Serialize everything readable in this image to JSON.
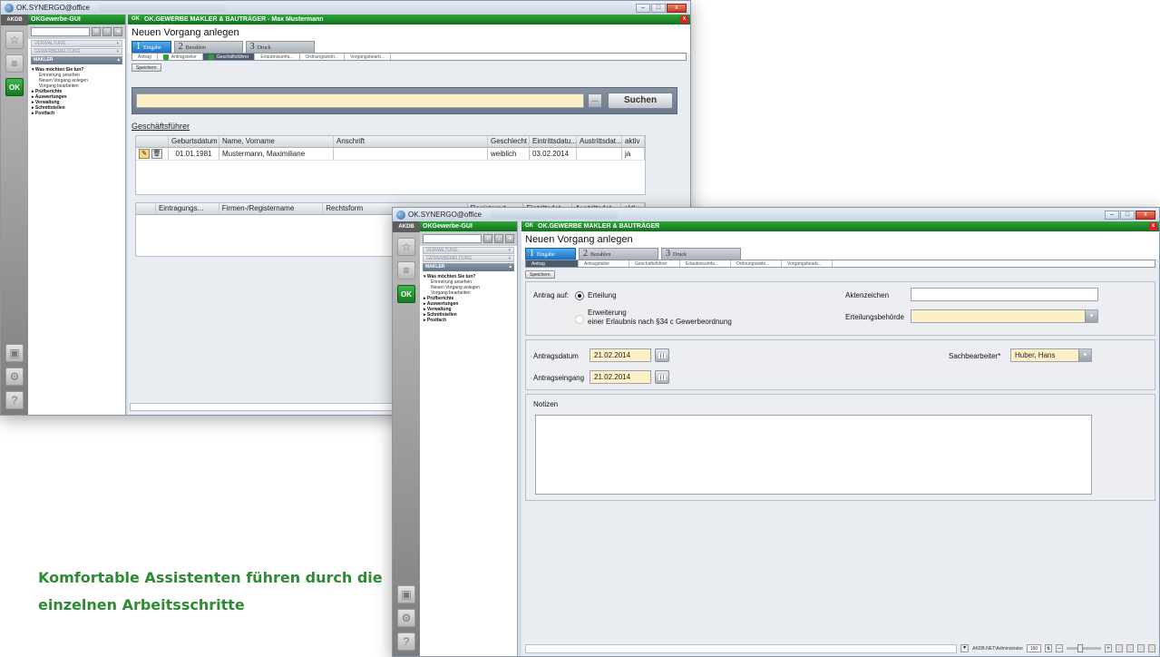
{
  "back_window": {
    "title": "OK.SYNERGO@office",
    "sidebar": {
      "title": "OKGewerbe-GUI",
      "groups": [
        "VERWALTUNG",
        "GEWERBEMELDUNG"
      ],
      "section": "MAKLER",
      "tree": [
        {
          "label": "Was möchten Sie tun?",
          "bold": true,
          "children": [
            "Erinnerung ansehen",
            "Neuen Vorgang anlegen",
            "Vorgang bearbeiten"
          ]
        },
        {
          "label": "Prüfberichte",
          "bold": true
        },
        {
          "label": "Auswertungen",
          "bold": true
        },
        {
          "label": "Verwaltung",
          "bold": true
        },
        {
          "label": "Schnittstellen",
          "bold": true
        },
        {
          "label": "Postfach",
          "bold": true
        }
      ]
    },
    "header": "OK.GEWERBE  MAKLER & BAUTRÄGER - Max Mustermann",
    "page_title": "Neuen Vorgang anlegen",
    "steps": [
      {
        "num": "1",
        "label": "Eingabe"
      },
      {
        "num": "2",
        "label": "Bezahlen"
      },
      {
        "num": "3",
        "label": "Druck"
      }
    ],
    "subtabs": [
      "Antrag",
      "Antragsteller",
      "Geschäftsführer",
      "Erlaubnisumfa...",
      "Ordnungswidri...",
      "Vorgangsbearb..."
    ],
    "save_label": "Speichern",
    "search_button": "Suchen",
    "search_more": "...",
    "section_title": "Geschäftsführer",
    "table1": {
      "headers": [
        "Geburtsdatum",
        "Name, Vorname",
        "Anschrift",
        "Geschlecht",
        "Eintrittsdatu...",
        "Austrittsdat...",
        "aktiv"
      ],
      "rows": [
        [
          "01.01.1981",
          "Mustermann, Maximiliane",
          "",
          "weiblich",
          "03.02.2014",
          "",
          "ja"
        ]
      ]
    },
    "table2": {
      "headers": [
        "Eintragungs...",
        "Firmen-/Registername",
        "Rechtsform",
        "Registerart",
        "Eintrittsdat...",
        "Austrittsdat...",
        "aktiv"
      ]
    }
  },
  "front_window": {
    "title": "OK.SYNERGO@office",
    "sidebar": {
      "title": "OKGewerbe-GUI",
      "groups": [
        "VERWALTUNG",
        "GEWERBEMELDUNG"
      ],
      "section": "MAKLER",
      "tree": [
        {
          "label": "Was möchten Sie tun?",
          "bold": true,
          "children": [
            "Erinnerung ansehen",
            "Neuen Vorgang anlegen",
            "Vorgang bearbeiten"
          ]
        },
        {
          "label": "Prüfberichte",
          "bold": true
        },
        {
          "label": "Auswertungen",
          "bold": true
        },
        {
          "label": "Verwaltung",
          "bold": true
        },
        {
          "label": "Schnittstellen",
          "bold": true
        },
        {
          "label": "Postfach",
          "bold": true
        }
      ]
    },
    "header": "OK.GEWERBE  MAKLER & BAUTRÄGER",
    "page_title": "Neuen Vorgang anlegen",
    "steps": [
      {
        "num": "1",
        "label": "Eingabe"
      },
      {
        "num": "2",
        "label": "Bezahlen"
      },
      {
        "num": "3",
        "label": "Druck"
      }
    ],
    "subtabs": [
      "Antrag",
      "Antragsteller",
      "Geschäftsführer",
      "Erlaubnisumfa...",
      "Ordnungswidri...",
      "Vorgangsbearb..."
    ],
    "save_label": "Speichern",
    "form": {
      "antrag_auf": "Antrag auf:",
      "erteilung": "Erteilung",
      "erweiterung_1": "Erweiterung",
      "erweiterung_2": "einer Erlaubnis nach §34 c Gewerbeordnung",
      "aktenzeichen": "Aktenzeichen",
      "aktenzeichen_value": "",
      "erteilungsbehoerde": "Erteilungsbehörde",
      "erteilungsbehoerde_value": "",
      "antragsdatum": "Antragsdatum",
      "antragsdatum_value": "21.02.2014",
      "antragseingang": "Antragseingang",
      "antragseingang_value": "21.02.2014",
      "sachbearbeiter": "Sachbearbeiter*",
      "sachbearbeiter_value": "Huber, Hans",
      "notizen": "Notizen",
      "notizen_value": ""
    },
    "statusbar": {
      "user": "AKDB.NET\\Administrator",
      "zoom": "150"
    }
  },
  "caption": {
    "line1": "Komfortable Assistenten führen durch die",
    "line2": "einzelnen Arbeitsschritte"
  },
  "colors": {
    "ok_green": "#11721d",
    "step_blue": "#1c6fc1",
    "caption_green": "#2e8a33",
    "field_yellow": "#fdf0c6"
  }
}
